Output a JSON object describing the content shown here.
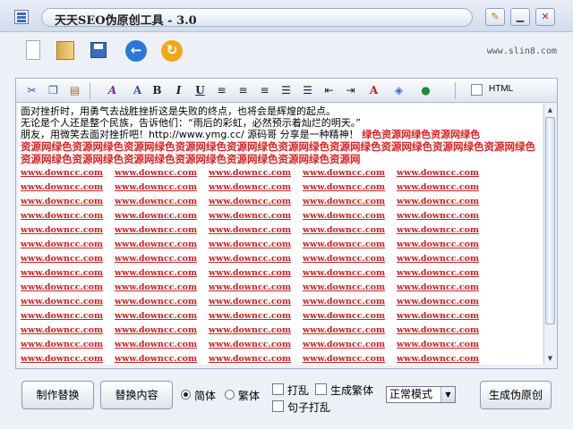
{
  "window": {
    "title": "天天SEO伪原创工具 - 3.0"
  },
  "header": {
    "site_url": "www.slin8.com"
  },
  "toolbar": {
    "icons": [
      "new-file-icon",
      "open-folder-icon",
      "save-icon",
      "back-icon",
      "redo-icon"
    ]
  },
  "format_toolbar": {
    "bold": "B",
    "italic": "I",
    "underline": "U",
    "html_label": "HTML",
    "html_checked": false
  },
  "editor": {
    "lines": [
      "面对挫折时，用勇气去战胜挫折这是失败的终点，也将会是辉煌的起点。",
      "无论是个人还是整个民族，告诉他们：“雨后的彩虹，必然预示着灿烂的明天。”",
      "朋友，用微笑去面对挫折吧！http://www.ymg.cc/ 源码哥 分享是一种精神！"
    ],
    "highlight_run": "绿色资源网绿色资源网绿色",
    "red_block": "资源网绿色资源网绿色资源网绿色资源网绿色资源网绿色资源网绿色资源网绿色资源网绿色资源网绿色资源网绿色资源网绿色资源网绿色资源网绿色资源网绿色资源网绿色资源网绿色资源网",
    "link_text": "www.downcc.com",
    "link_rows": 14,
    "links_per_row": 5
  },
  "options": {
    "make_replace": "制作替换",
    "replace_content": "替换内容",
    "simplified": "简体",
    "traditional": "繁体",
    "simplified_selected": true,
    "shuffle": "打乱",
    "gen_traditional": "生成繁体",
    "sentence_shuffle": "句子打乱",
    "mode": "正常模式",
    "generate": "生成伪原创"
  }
}
